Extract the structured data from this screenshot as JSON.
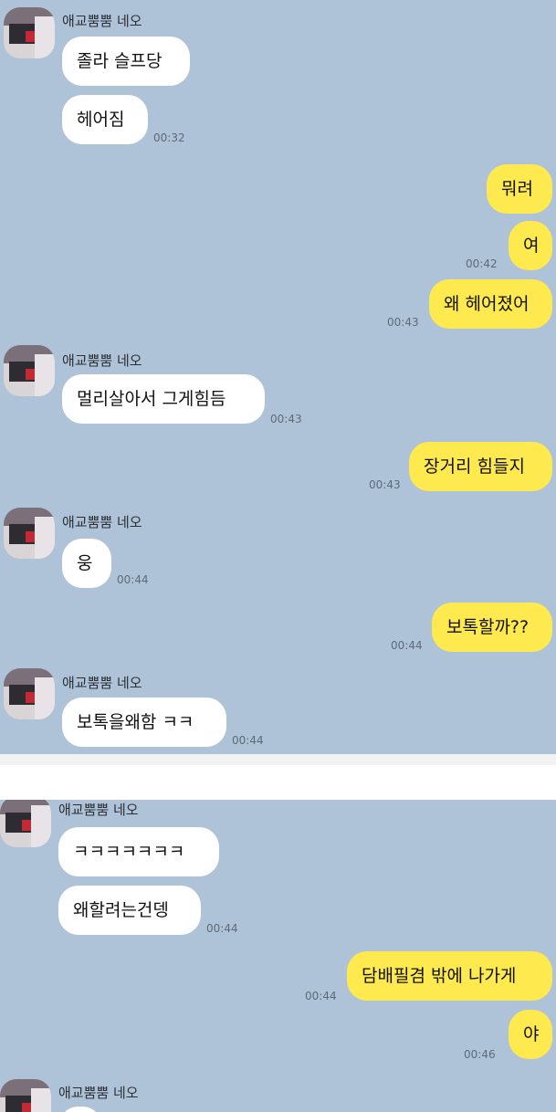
{
  "contact_name": "애교뿜뿜 네오",
  "messages": [
    {
      "text": "졸라 슬프당"
    },
    {
      "text": "헤어짐",
      "time": "00:32"
    },
    {
      "text": "뭐려"
    },
    {
      "text": "여",
      "time": "00:42"
    },
    {
      "text": "왜 헤어졌어",
      "time": "00:43"
    },
    {
      "text": "멀리살아서 그게힘듬",
      "time": "00:43"
    },
    {
      "text": "장거리 힘들지",
      "time": "00:43"
    },
    {
      "text": "웅",
      "time": "00:44"
    },
    {
      "text": "보톡할까??",
      "time": "00:44"
    },
    {
      "text": "보톡을왜함 ㅋㅋ",
      "time": "00:44"
    },
    {
      "text": "ㅋㅋㅋㅋㅋㅋㅋ"
    },
    {
      "text": "왜할려는건뎅",
      "time": "00:44"
    },
    {
      "text": "담배필겸 밖에 나가게",
      "time": "00:44"
    },
    {
      "text": "야",
      "time": "00:46"
    }
  ],
  "colors": {
    "chat_background": "#afc3d8",
    "incoming_bubble": "#ffffff",
    "outgoing_bubble": "#fee94f"
  }
}
